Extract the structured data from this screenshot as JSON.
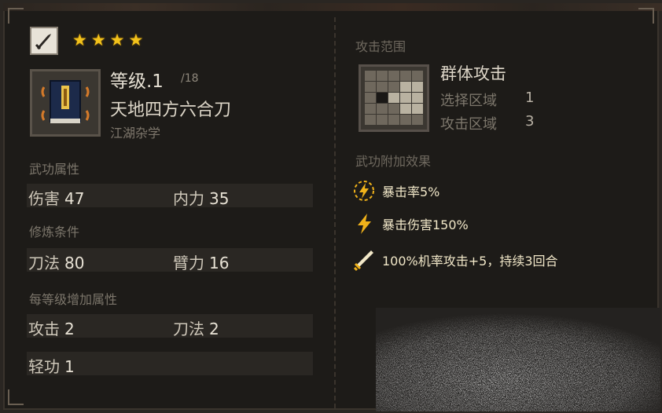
{
  "skill": {
    "type_icon": "sword-icon",
    "stars": 4,
    "level_label": "等级.1",
    "level_max": "/18",
    "name": "天地四方六合刀",
    "category": "江湖杂学",
    "book_icon": "martial-book-icon"
  },
  "attributes": {
    "title": "武功属性",
    "items": [
      {
        "label": "伤害",
        "value": "47"
      },
      {
        "label": "内力",
        "value": "35"
      }
    ]
  },
  "requirements": {
    "title": "修炼条件",
    "items": [
      {
        "label": "刀法",
        "value": "80"
      },
      {
        "label": "臂力",
        "value": "16"
      }
    ]
  },
  "per_level": {
    "title": "每等级增加属性",
    "items": [
      {
        "label": "攻击",
        "value": "2"
      },
      {
        "label": "刀法",
        "value": "2"
      },
      {
        "label": "轻功",
        "value": "1"
      }
    ]
  },
  "range": {
    "title": "攻击范围",
    "name": "群体攻击",
    "select_label": "选择区域",
    "select_value": "1",
    "attack_label": "攻击区域",
    "attack_value": "3"
  },
  "effects": {
    "title": "武功附加效果",
    "items": [
      {
        "icon": "lightning-circle-icon",
        "text": "暴击率5%"
      },
      {
        "icon": "lightning-icon",
        "text": "暴击伤害150%"
      },
      {
        "icon": "sword-icon",
        "text": "100%机率攻击+5，持续3回合"
      }
    ]
  },
  "colors": {
    "star": "#f2c21b",
    "effect_icon": "#f0b21a",
    "panel_bg": "#1d1b18"
  }
}
